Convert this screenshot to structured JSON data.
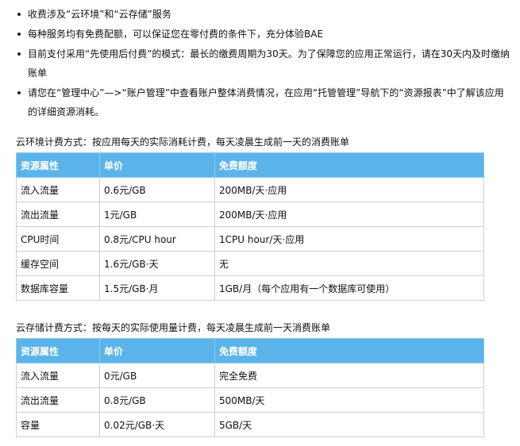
{
  "bullets": [
    "收费涉及“云环境”和“云存储”服务",
    "每种服务均有免费配额，可以保证您在零付费的条件下，充分体验BAE",
    "目前支付采用“先使用后付费”的模式：最长的缴费周期为30天。为了保障您的应用正常运行，请在30天内及时缴纳账单",
    "请您在“管理中心”—>“账户管理”中查看账户整体消费情况，在应用“托管管理”导航下的“资源报表”中了解该应用的详细资源消耗。"
  ],
  "env": {
    "title": "云环境计费方式：按应用每天的实际消耗计费，每天凌晨生成前一天的消费账单",
    "headers": [
      "资源属性",
      "单价",
      "免费额度"
    ],
    "rows": [
      [
        "流入流量",
        "0.6元/GB",
        "200MB/天·应用"
      ],
      [
        "流出流量",
        "1元/GB",
        "200MB/天·应用"
      ],
      [
        "CPU时间",
        "0.8元/CPU hour",
        "1CPU hour/天·应用"
      ],
      [
        "缓存空间",
        "1.6元/GB·天",
        "无"
      ],
      [
        "数据库容量",
        "1.5元/GB·月",
        "1GB/月（每个应用有一个数据库可使用）"
      ]
    ]
  },
  "storage": {
    "title": "云存储计费方式：按每天的实际使用量计费，每天凌晨生成前一天消费账单",
    "headers": [
      "资源属性",
      "单价",
      "免费额度"
    ],
    "rows": [
      [
        "流入流量",
        "0元/GB",
        "完全免费"
      ],
      [
        "流出流量",
        "0.8元/GB",
        "500MB/天"
      ],
      [
        "容量",
        "0.02元/GB·天",
        "5GB/天"
      ]
    ]
  }
}
